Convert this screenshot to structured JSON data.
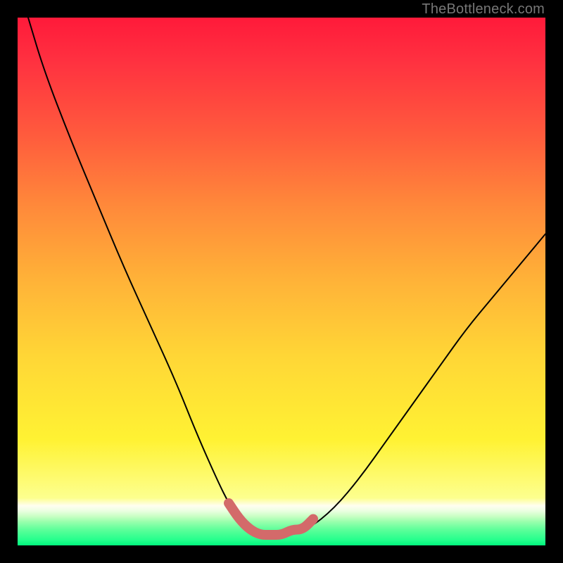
{
  "watermark": "TheBottleneck.com",
  "chart_data": {
    "type": "line",
    "title": "",
    "xlabel": "",
    "ylabel": "",
    "xlim": [
      0,
      100
    ],
    "ylim": [
      0,
      100
    ],
    "series": [
      {
        "name": "bottleneck-curve",
        "color": "#000000",
        "x": [
          2,
          5,
          10,
          15,
          20,
          25,
          30,
          34,
          38,
          40,
          42,
          44,
          46,
          50,
          55,
          60,
          65,
          70,
          75,
          80,
          85,
          90,
          95,
          100
        ],
        "y": [
          100,
          90,
          77,
          65,
          53,
          42,
          31,
          21,
          12,
          8,
          5,
          3,
          2,
          2,
          3,
          7,
          13,
          20,
          27,
          34,
          41,
          47,
          53,
          59
        ]
      },
      {
        "name": "highlight-segment",
        "color": "#d36a6a",
        "x": [
          40,
          42,
          44,
          46,
          48,
          50,
          52,
          54,
          56
        ],
        "y": [
          8,
          5,
          3,
          2,
          2,
          2,
          3,
          3,
          5
        ]
      }
    ],
    "grid": false,
    "legend": false
  }
}
